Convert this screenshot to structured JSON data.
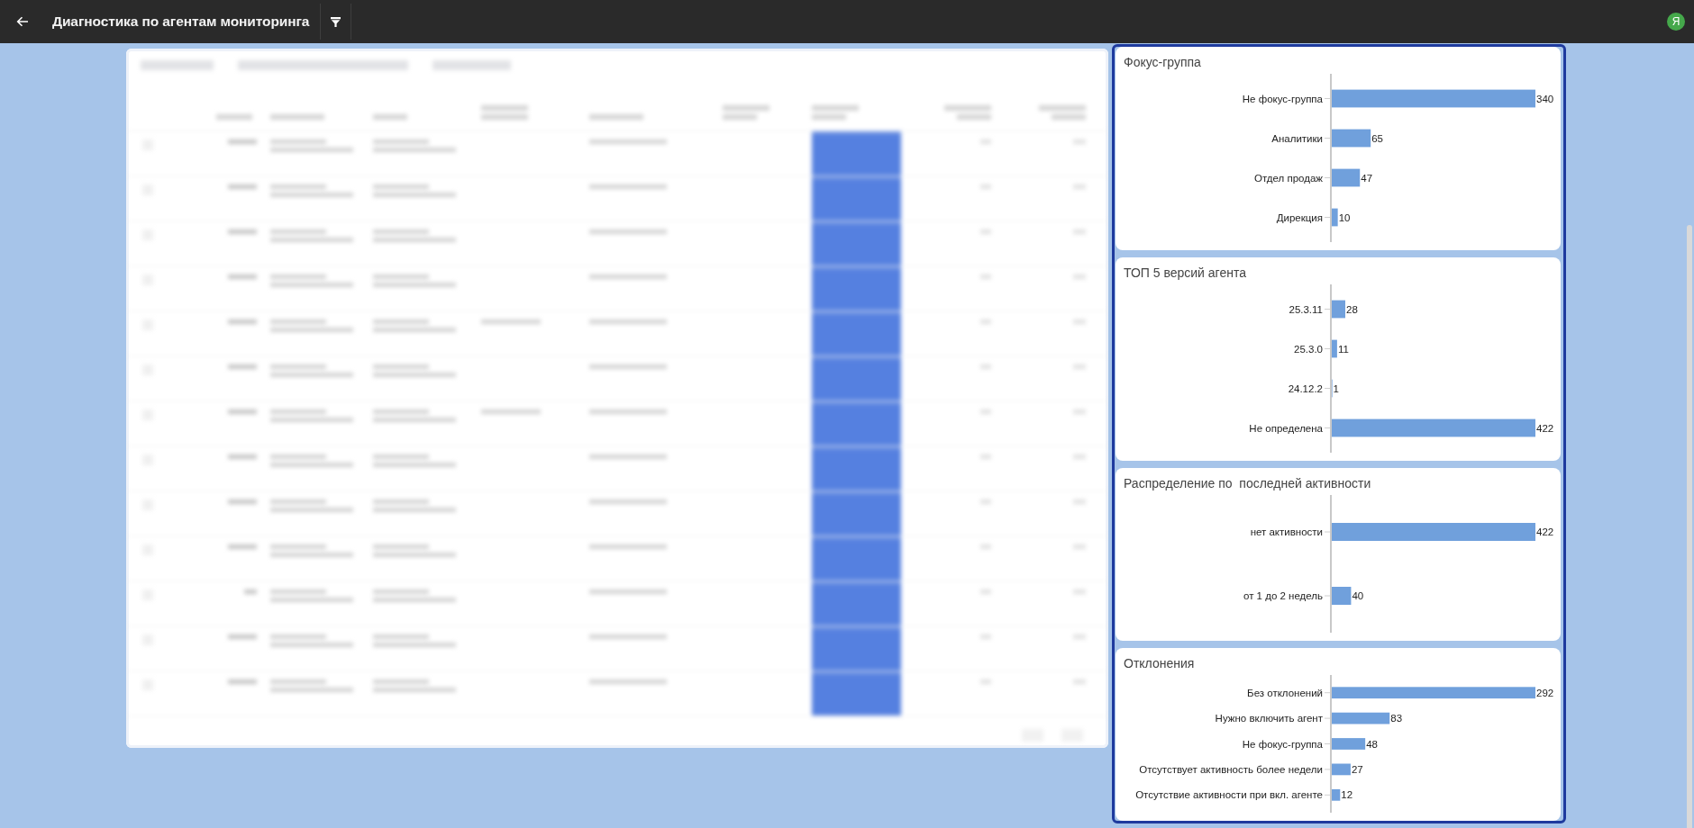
{
  "header": {
    "title": "Диагностика по агентам мониторинга",
    "avatar_initial": "Я"
  },
  "charts": [
    {
      "chart_data": {
        "type": "bar",
        "orientation": "horizontal",
        "title": "Фокус-группа",
        "categories": [
          "Не фокус-группа",
          "Аналитики",
          "Отдел продаж",
          "Дирекция"
        ],
        "values": [
          340,
          65,
          47,
          10
        ],
        "data_labels": true
      }
    },
    {
      "chart_data": {
        "type": "bar",
        "orientation": "horizontal",
        "title": "ТОП 5 версий агента",
        "categories": [
          "25.3.11",
          "25.3.0",
          "24.12.2",
          "Не определена"
        ],
        "values": [
          28,
          11,
          1,
          422
        ],
        "data_labels": true
      }
    },
    {
      "chart_data": {
        "type": "bar",
        "orientation": "horizontal",
        "title": "Распределение по  последней активности",
        "categories": [
          "нет активности",
          "от 1 до 2 недель"
        ],
        "values": [
          422,
          40
        ],
        "data_labels": true
      }
    },
    {
      "chart_data": {
        "type": "bar",
        "orientation": "horizontal",
        "title": "Отклонения",
        "categories": [
          "Без отклонений",
          "Нужно включить агент",
          "Не фокус-группа",
          "Отсутствует активность более недели",
          "Отсутствие активности при вкл. агенте"
        ],
        "values": [
          292,
          83,
          48,
          27,
          12
        ],
        "data_labels": true
      }
    }
  ]
}
